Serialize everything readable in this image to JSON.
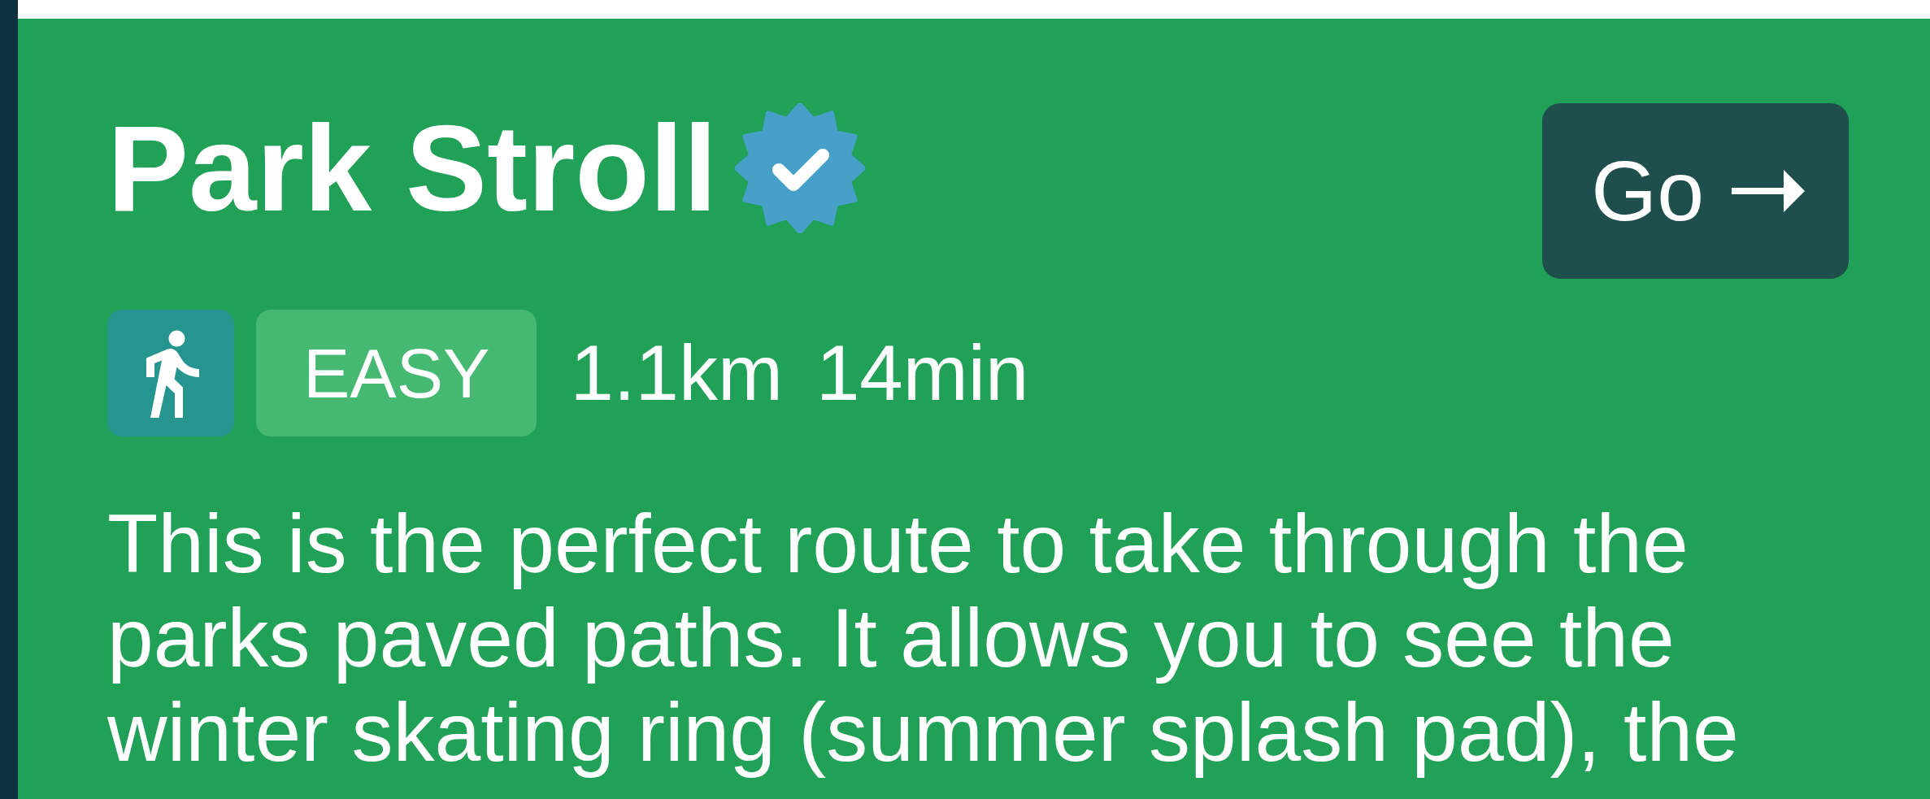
{
  "route": {
    "title": "Park Stroll",
    "verified": true,
    "go_button": {
      "label": "Go"
    },
    "mode": {
      "kind": "walk"
    },
    "difficulty": "EASY",
    "distance": "1.1km",
    "duration": "14min",
    "description": "This is the perfect route to take through the parks paved paths. It allows you to see the winter skating ring (summer splash pad), the"
  }
}
